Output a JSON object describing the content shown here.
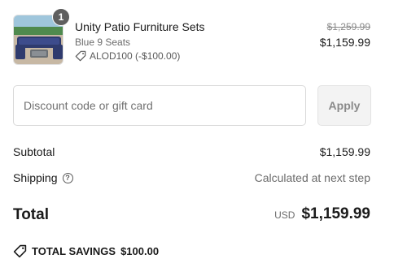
{
  "cart": {
    "item": {
      "quantity": "1",
      "title": "Unity Patio Furniture Sets",
      "variant": "Blue 9 Seats",
      "discount": "ALOD100 (-$100.00)",
      "original_price": "$1,259.99",
      "price": "$1,159.99",
      "image_icon": "patio-furniture-product-image"
    }
  },
  "discount": {
    "placeholder": "Discount code or gift card",
    "value": "",
    "apply_label": "Apply"
  },
  "summary": {
    "subtotal_label": "Subtotal",
    "subtotal_value": "$1,159.99",
    "shipping_label": "Shipping",
    "shipping_help_glyph": "?",
    "shipping_value": "Calculated at next step",
    "total_label": "Total",
    "currency": "USD",
    "total_value": "$1,159.99",
    "savings_label": "TOTAL SAVINGS",
    "savings_value": "$100.00"
  },
  "icons": {
    "discount_tag": "tag-icon",
    "help": "question-circle-icon",
    "savings_tag": "tag-icon"
  },
  "colors": {
    "badge": "#5f5f5f",
    "muted_text": "#6b6b6b",
    "apply_button_bg": "#f3f3f3"
  }
}
